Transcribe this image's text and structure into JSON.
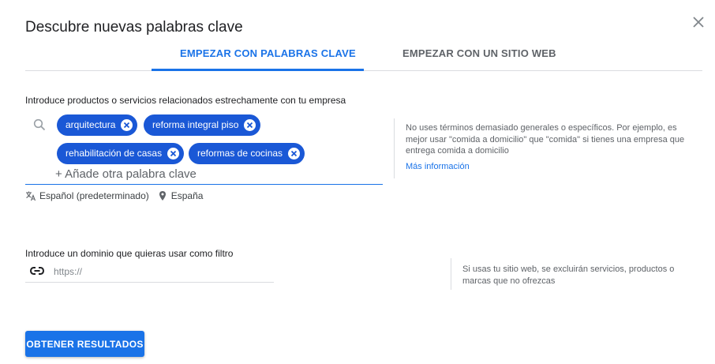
{
  "dialog": {
    "title": "Descubre nuevas palabras clave",
    "close_icon": "close-icon"
  },
  "tabs": [
    {
      "label": "EMPEZAR CON PALABRAS CLAVE",
      "active": true
    },
    {
      "label": "EMPEZAR CON UN SITIO WEB",
      "active": false
    }
  ],
  "keywords": {
    "label": "Introduce productos o servicios relacionados estrechamente con tu empresa",
    "chips": [
      "arquitectura",
      "reforma integral piso",
      "rehabilitación de casas",
      "reformas de cocinas"
    ],
    "input_value": "",
    "placeholder": "+ Añade otra palabra clave",
    "language": "Español (predeterminado)",
    "location": "España"
  },
  "keywords_help": {
    "text": "No uses términos demasiado generales o específicos. Por ejemplo, es mejor usar \"comida a domicilio\" que \"comida\" si tienes una empresa que entrega comida a domicilio",
    "link": "Más información"
  },
  "domain": {
    "label": "Introduce un dominio que quieras usar como filtro",
    "input_value": "",
    "placeholder": "https://",
    "help": "Si usas tu sitio web, se excluirán servicios, productos o marcas que no ofrezcas"
  },
  "actions": {
    "submit_label": "OBTENER RESULTADOS"
  },
  "colors": {
    "accent": "#1a73e8",
    "chip": "#1a58d6",
    "divider": "#dadce0"
  }
}
